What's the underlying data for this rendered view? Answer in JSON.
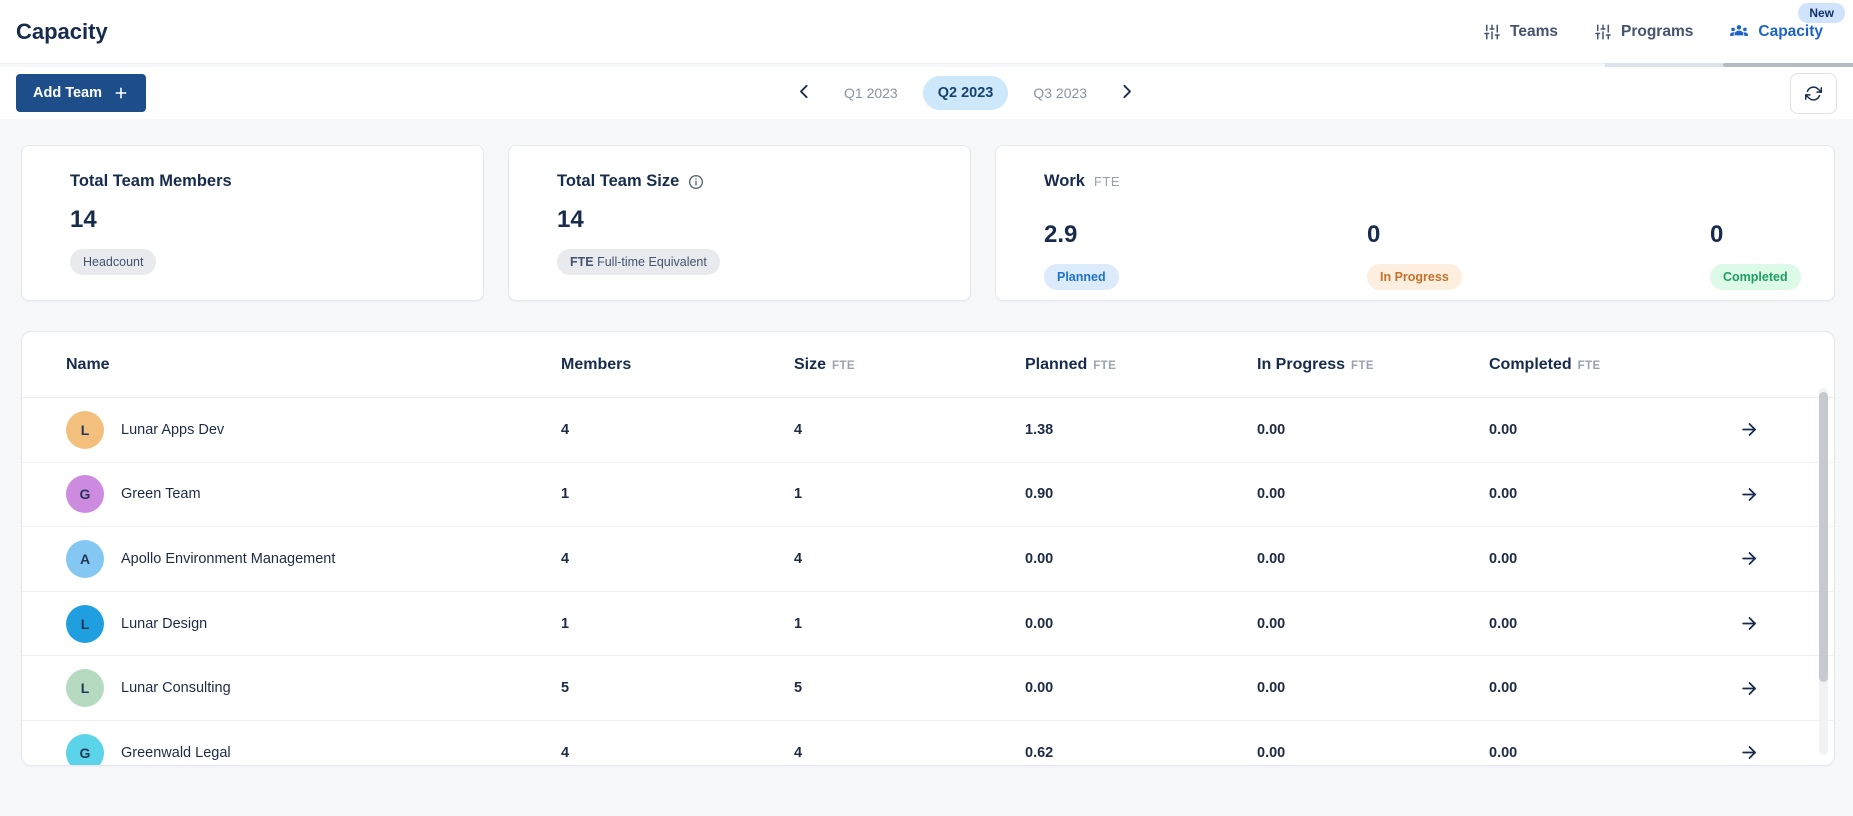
{
  "page": {
    "title": "Capacity"
  },
  "nav": {
    "new_badge": "New",
    "tabs": [
      {
        "id": "teams",
        "label": "Teams",
        "icon": "sliders-icon",
        "active": false
      },
      {
        "id": "programs",
        "label": "Programs",
        "icon": "sliders-icon",
        "active": false
      },
      {
        "id": "capacity",
        "label": "Capacity",
        "icon": "people-icon",
        "active": true
      }
    ]
  },
  "toolbar": {
    "add_team_label": "Add Team",
    "quarters": [
      {
        "label": "Q1 2023",
        "active": false
      },
      {
        "label": "Q2 2023",
        "active": true
      },
      {
        "label": "Q3 2023",
        "active": false
      }
    ]
  },
  "cards": {
    "members": {
      "title": "Total Team Members",
      "value": "14",
      "badge": "Headcount"
    },
    "size": {
      "title": "Total Team Size",
      "value": "14",
      "badge_strong": "FTE",
      "badge_rest": "Full-time Equivalent"
    },
    "work": {
      "title": "Work",
      "title_suffix": "FTE",
      "metrics": [
        {
          "value": "2.9",
          "badge": "Planned"
        },
        {
          "value": "0",
          "badge": "In Progress"
        },
        {
          "value": "0",
          "badge": "Completed"
        }
      ]
    }
  },
  "table": {
    "columns": [
      {
        "label": "Name",
        "suffix": ""
      },
      {
        "label": "Members",
        "suffix": ""
      },
      {
        "label": "Size",
        "suffix": "FTE"
      },
      {
        "label": "Planned",
        "suffix": "FTE"
      },
      {
        "label": "In Progress",
        "suffix": "FTE"
      },
      {
        "label": "Completed",
        "suffix": "FTE"
      }
    ],
    "rows": [
      {
        "initial": "L",
        "avatar_color": "#f2c07c",
        "name": "Lunar Apps Dev",
        "members": "4",
        "size": "4",
        "planned": "1.38",
        "in_progress": "0.00",
        "completed": "0.00"
      },
      {
        "initial": "G",
        "avatar_color": "#cd8be0",
        "name": "Green Team",
        "members": "1",
        "size": "1",
        "planned": "0.90",
        "in_progress": "0.00",
        "completed": "0.00"
      },
      {
        "initial": "A",
        "avatar_color": "#83c7f2",
        "name": "Apollo Environment Management",
        "members": "4",
        "size": "4",
        "planned": "0.00",
        "in_progress": "0.00",
        "completed": "0.00"
      },
      {
        "initial": "L",
        "avatar_color": "#1f9fe0",
        "name": "Lunar Design",
        "members": "1",
        "size": "1",
        "planned": "0.00",
        "in_progress": "0.00",
        "completed": "0.00"
      },
      {
        "initial": "L",
        "avatar_color": "#b6dabf",
        "name": "Lunar Consulting",
        "members": "5",
        "size": "5",
        "planned": "0.00",
        "in_progress": "0.00",
        "completed": "0.00"
      },
      {
        "initial": "G",
        "avatar_color": "#5bd3e8",
        "name": "Greenwald Legal",
        "members": "4",
        "size": "4",
        "planned": "0.62",
        "in_progress": "0.00",
        "completed": "0.00"
      }
    ]
  },
  "colors": {
    "accent_blue": "#1d63c8",
    "add_team_button": "#1d4e89",
    "quarter_active_bg": "#cde8fa",
    "new_badge_bg": "#cfe3fc",
    "planned_badge_bg": "#dcebfb",
    "planned_badge_text": "#1d72c9",
    "inprogress_badge_bg": "#fdeedf",
    "inprogress_badge_text": "#c4712a",
    "completed_badge_bg": "#ddf9e7",
    "completed_badge_text": "#1d9e62",
    "neutral_badge_bg": "#e8eaee",
    "neutral_badge_text": "#44546f"
  }
}
